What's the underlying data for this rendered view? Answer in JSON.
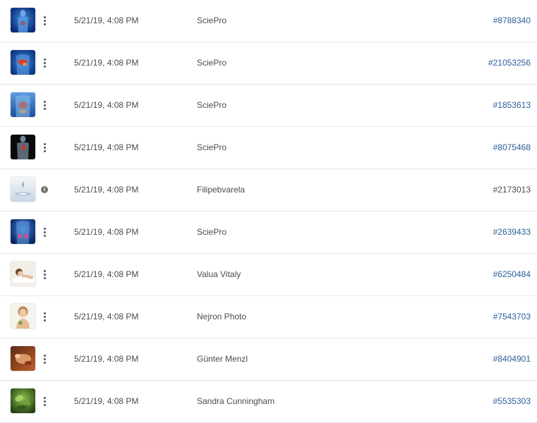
{
  "colors": {
    "link": "#2d5f9a",
    "text": "#4b4b4b",
    "divider": "#e6e6e6"
  },
  "rows": [
    {
      "thumbnail": "anatomy-body-blue",
      "action": "more",
      "date": "5/21/19, 4:08 PM",
      "author": "SciePro",
      "id": "#8788340",
      "linked": true
    },
    {
      "thumbnail": "anatomy-liver",
      "action": "more",
      "date": "5/21/19, 4:08 PM",
      "author": "SciePro",
      "id": "#21053256",
      "linked": true
    },
    {
      "thumbnail": "anatomy-torso-organs",
      "action": "more",
      "date": "5/21/19, 4:08 PM",
      "author": "SciePro",
      "id": "#1853613",
      "linked": true
    },
    {
      "thumbnail": "anatomy-heart-dark",
      "action": "more",
      "date": "5/21/19, 4:08 PM",
      "author": "SciePro",
      "id": "#8075468",
      "linked": true
    },
    {
      "thumbnail": "water-drop",
      "action": "info",
      "date": "5/21/19, 4:08 PM",
      "author": "Filipebvarela",
      "id": "#2173013",
      "linked": false
    },
    {
      "thumbnail": "anatomy-kidneys",
      "action": "more",
      "date": "5/21/19, 4:08 PM",
      "author": "SciePro",
      "id": "#2639433",
      "linked": true
    },
    {
      "thumbnail": "spa-woman-relaxing",
      "action": "more",
      "date": "5/21/19, 4:08 PM",
      "author": "Valua Vitaly",
      "id": "#6250484",
      "linked": true
    },
    {
      "thumbnail": "woman-portrait",
      "action": "more",
      "date": "5/21/19, 4:08 PM",
      "author": "Nejron Photo",
      "id": "#7543703",
      "linked": true
    },
    {
      "thumbnail": "massage-treatment",
      "action": "more",
      "date": "5/21/19, 4:08 PM",
      "author": "Günter Menzl",
      "id": "#8404901",
      "linked": true
    },
    {
      "thumbnail": "green-leaves",
      "action": "more",
      "date": "5/21/19, 4:08 PM",
      "author": "Sandra Cunningham",
      "id": "#5535303",
      "linked": true
    }
  ]
}
